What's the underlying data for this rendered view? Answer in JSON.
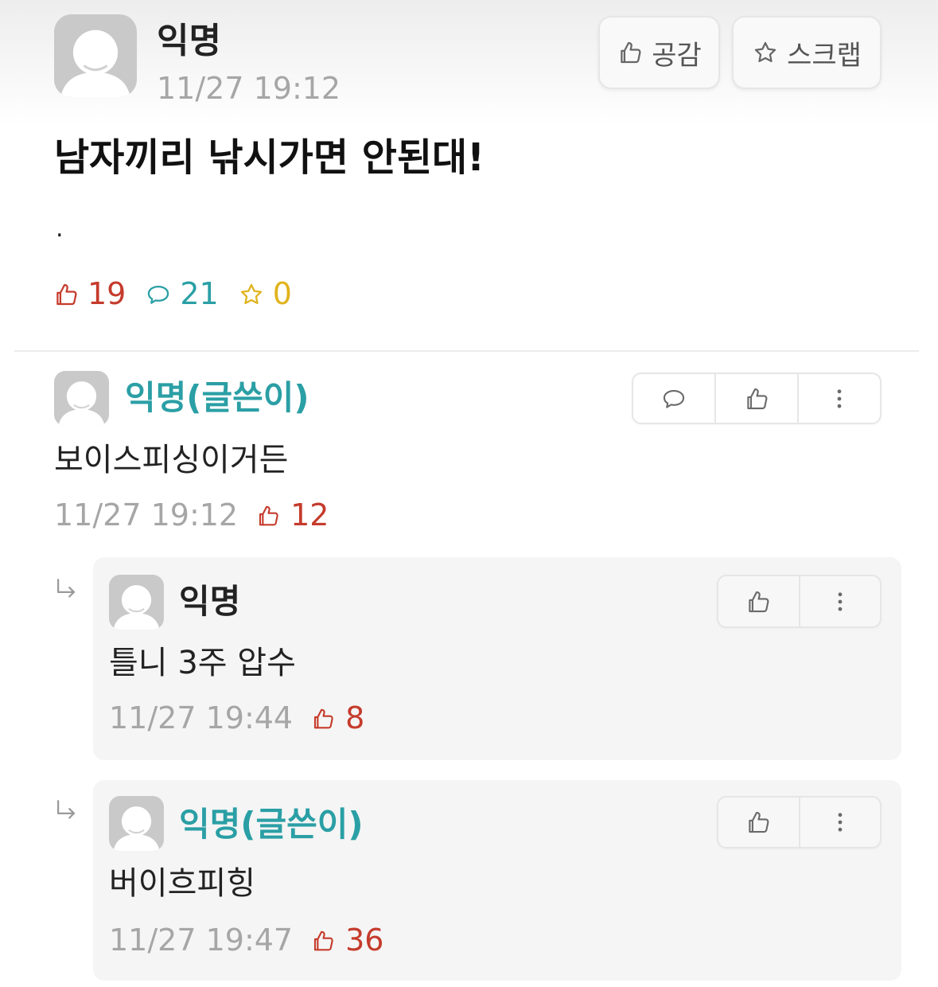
{
  "post": {
    "author": "익명",
    "timestamp": "11/27 19:12",
    "title": "남자끼리 낚시가면 안된대!",
    "body": ".",
    "actions": {
      "like_label": "공감",
      "scrap_label": "스크랩"
    },
    "stats": {
      "likes": 19,
      "comments": 21,
      "scraps": 0
    }
  },
  "comments": [
    {
      "author": "익명(글쓴이)",
      "is_op": true,
      "text": "보이스피싱이거든",
      "timestamp": "11/27 19:12",
      "likes": 12,
      "replies": [
        {
          "author": "익명",
          "is_op": false,
          "text": "틀니 3주 압수",
          "timestamp": "11/27 19:44",
          "likes": 8
        },
        {
          "author": "익명(글쓴이)",
          "is_op": true,
          "text": "버이흐피힝",
          "timestamp": "11/27 19:47",
          "likes": 36
        }
      ]
    }
  ],
  "icons": {
    "avatar": "default-avatar-icon",
    "like": "thumbs-up-icon",
    "comment": "comment-icon",
    "scrap": "star-icon",
    "more": "more-vertical-icon",
    "reply": "reply-arrow-icon"
  },
  "colors": {
    "accent": "#2a9fa5",
    "like": "#c53b2c",
    "scrap": "#e0b31c",
    "meta": "#a6a6a6",
    "text": "#222222",
    "reply_bg": "#f5f5f5",
    "avatar_bg": "#c9c9c9",
    "border": "#e6e6e6"
  }
}
